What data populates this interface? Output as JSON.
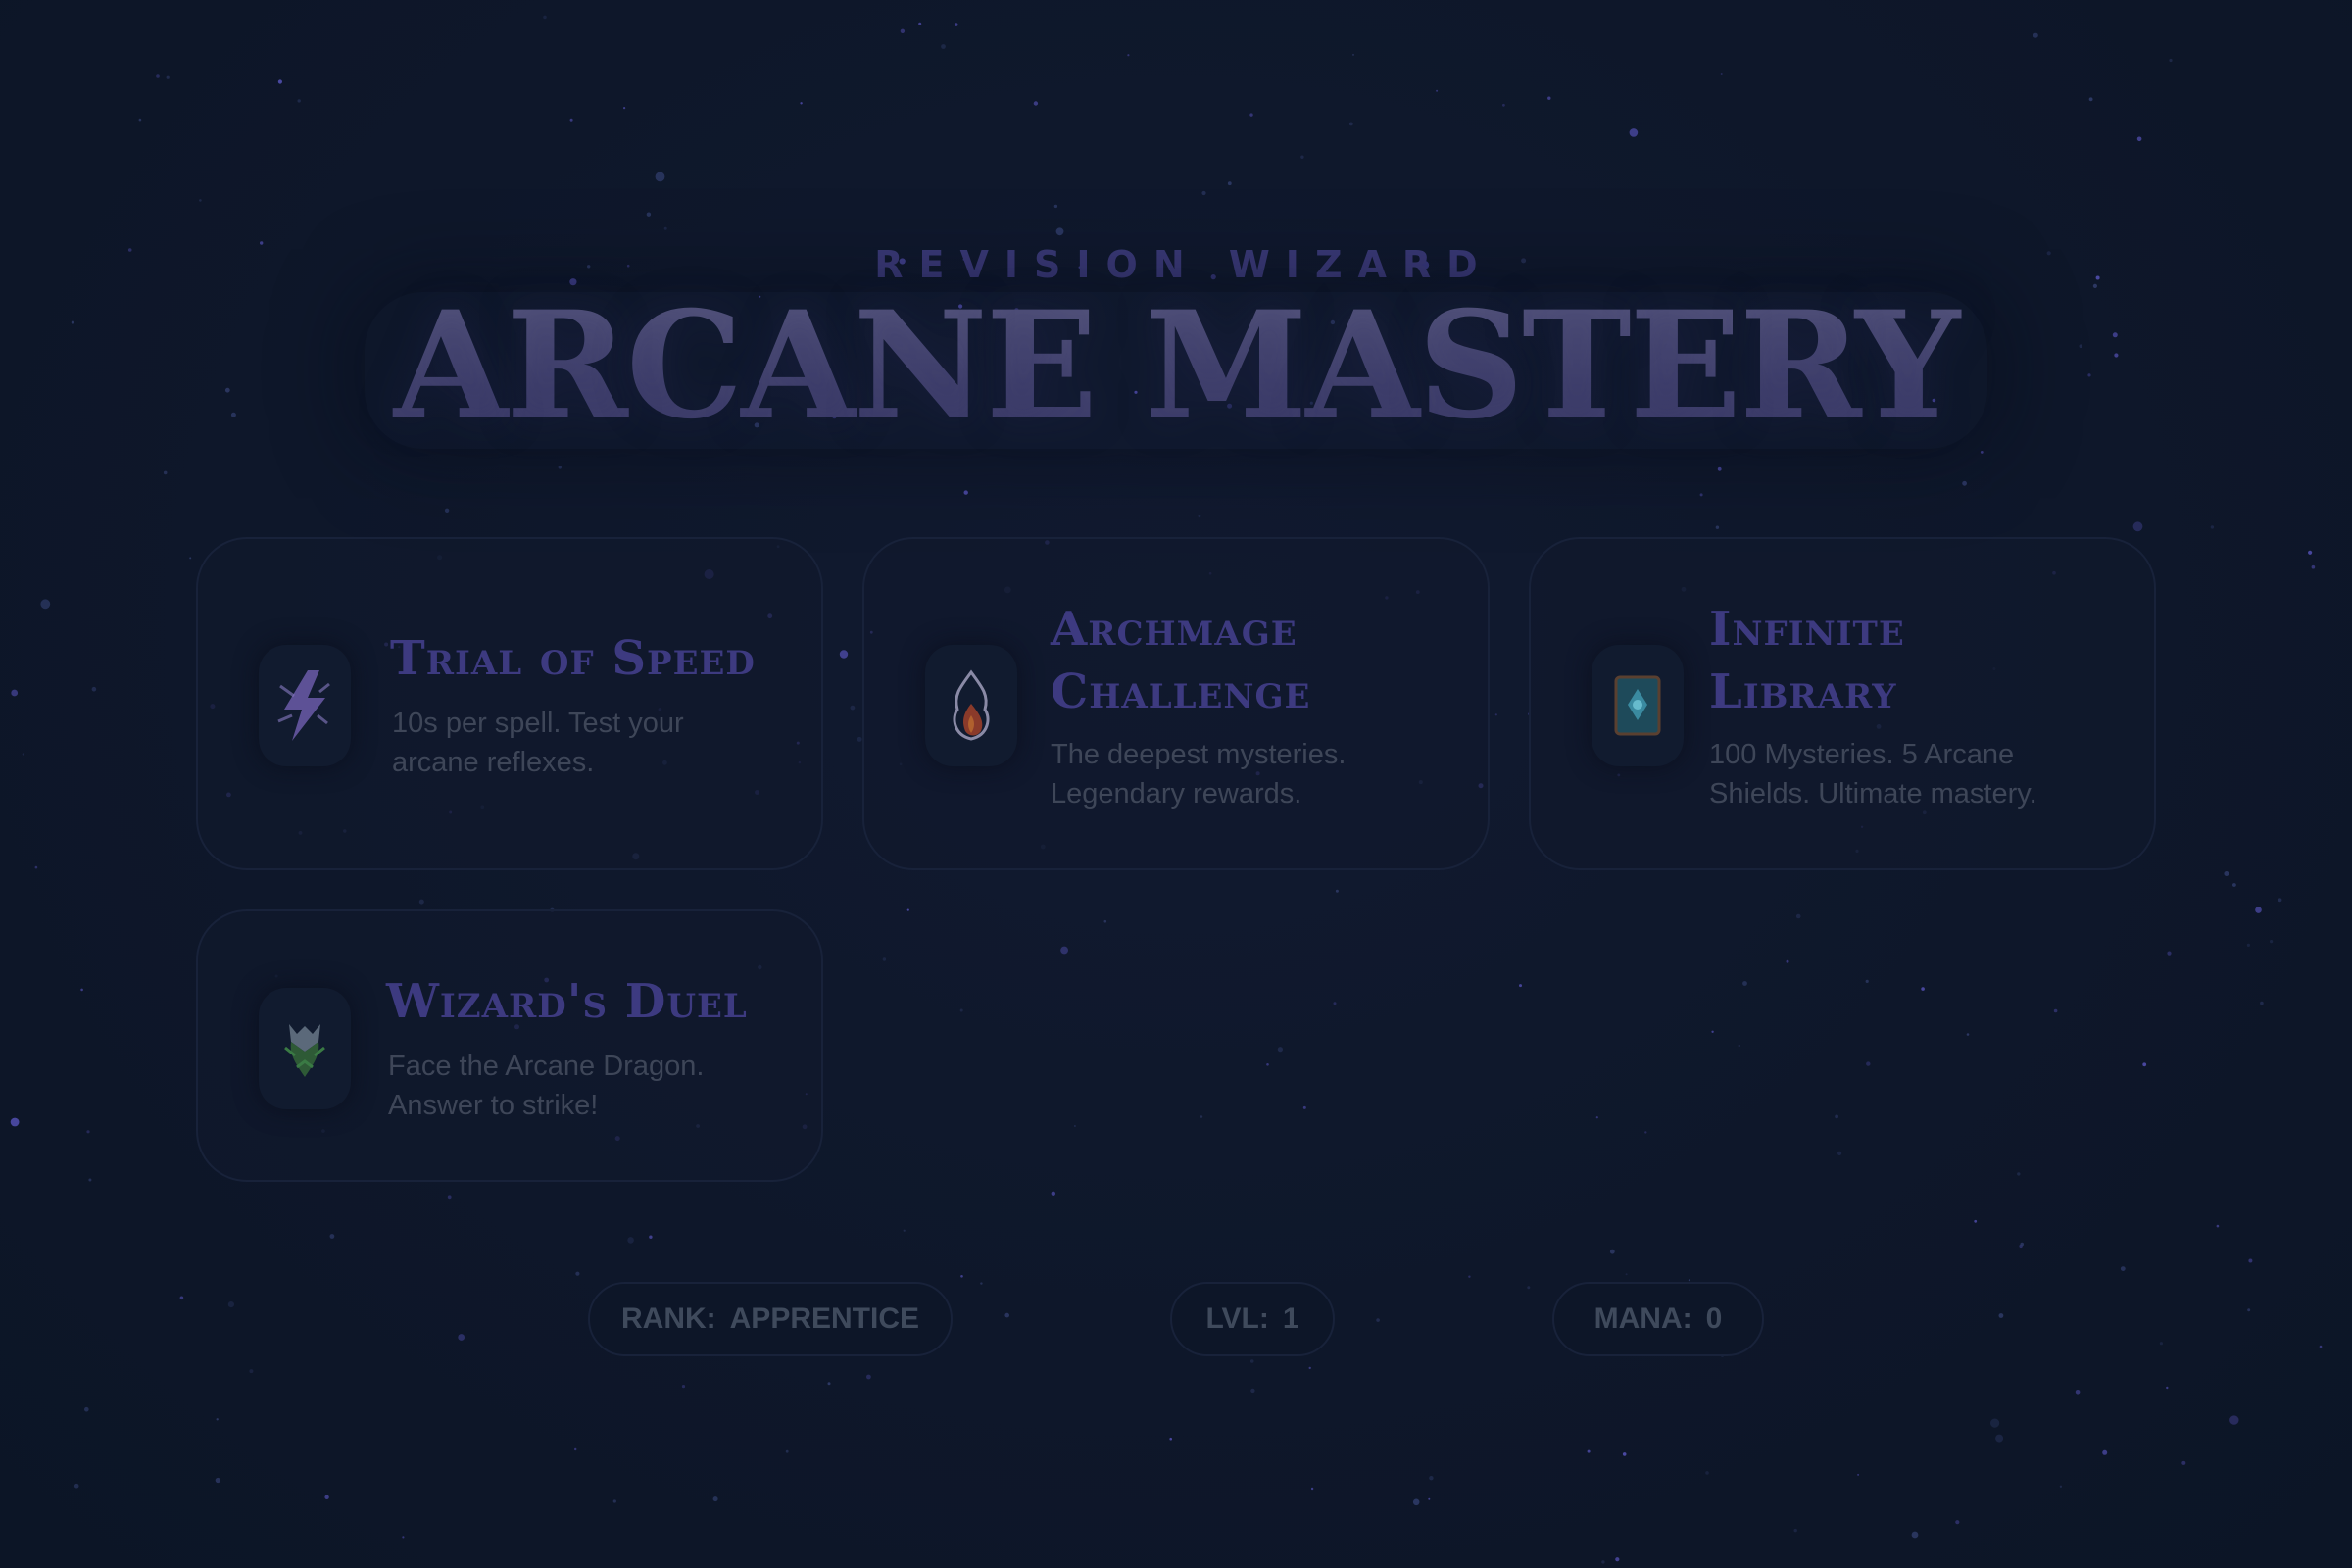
{
  "header": {
    "subtitle": "REVISION WIZARD",
    "title": "ARCANE MASTERY"
  },
  "modes": [
    {
      "title_line1": "Trial of Speed",
      "title_line2": "",
      "description_line1": "10s per spell. Test your",
      "description_line2": "arcane reflexes.",
      "icon": "lightning-bolt-icon"
    },
    {
      "title_line1": "Archmage",
      "title_line2": "Challenge",
      "description_line1": "The deepest mysteries.",
      "description_line2": "Legendary rewards.",
      "icon": "flame-icon"
    },
    {
      "title_line1": "Infinite",
      "title_line2": "Library",
      "description_line1": "100 Mysteries. 5 Arcane",
      "description_line2": "Shields. Ultimate mastery.",
      "icon": "spellbook-icon"
    },
    {
      "title_line1": "Wizard's Duel",
      "title_line2": "",
      "description_line1": "Face the Arcane Dragon.",
      "description_line2": "Answer to strike!",
      "icon": "dragon-icon"
    }
  ],
  "stats": {
    "rank_label": "RANK:",
    "rank_value": "APPRENTICE",
    "level_label": "LVL:",
    "level_value": "1",
    "mana_label": "MANA:",
    "mana_value": "0"
  },
  "colors": {
    "background": "#0e172a",
    "accent": "#3d3a80",
    "star": "#4e4ba8"
  }
}
